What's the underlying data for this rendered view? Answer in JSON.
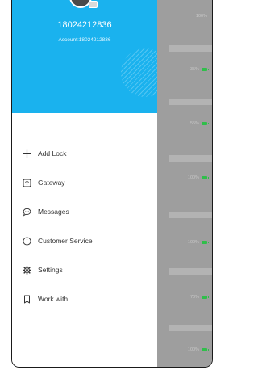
{
  "profile": {
    "phone": "18024212836",
    "account": "Account:18024212836"
  },
  "menu": {
    "items": [
      {
        "label": "Add Lock",
        "icon": "plus-icon"
      },
      {
        "label": "Gateway",
        "icon": "gateway-icon"
      },
      {
        "label": "Messages",
        "icon": "message-icon"
      },
      {
        "label": "Customer Service",
        "icon": "info-icon"
      },
      {
        "label": "Settings",
        "icon": "gear-icon"
      },
      {
        "label": "Work with",
        "icon": "bookmark-icon"
      }
    ]
  },
  "locks": [
    {
      "battery": "100%"
    },
    {
      "battery": "35%"
    },
    {
      "battery": "55%"
    },
    {
      "battery": "100%"
    },
    {
      "battery": "100%"
    },
    {
      "battery": "70%"
    },
    {
      "battery": "100%"
    }
  ],
  "colors": {
    "header": "#1ab2ee",
    "battery": "#2fbf4a"
  }
}
